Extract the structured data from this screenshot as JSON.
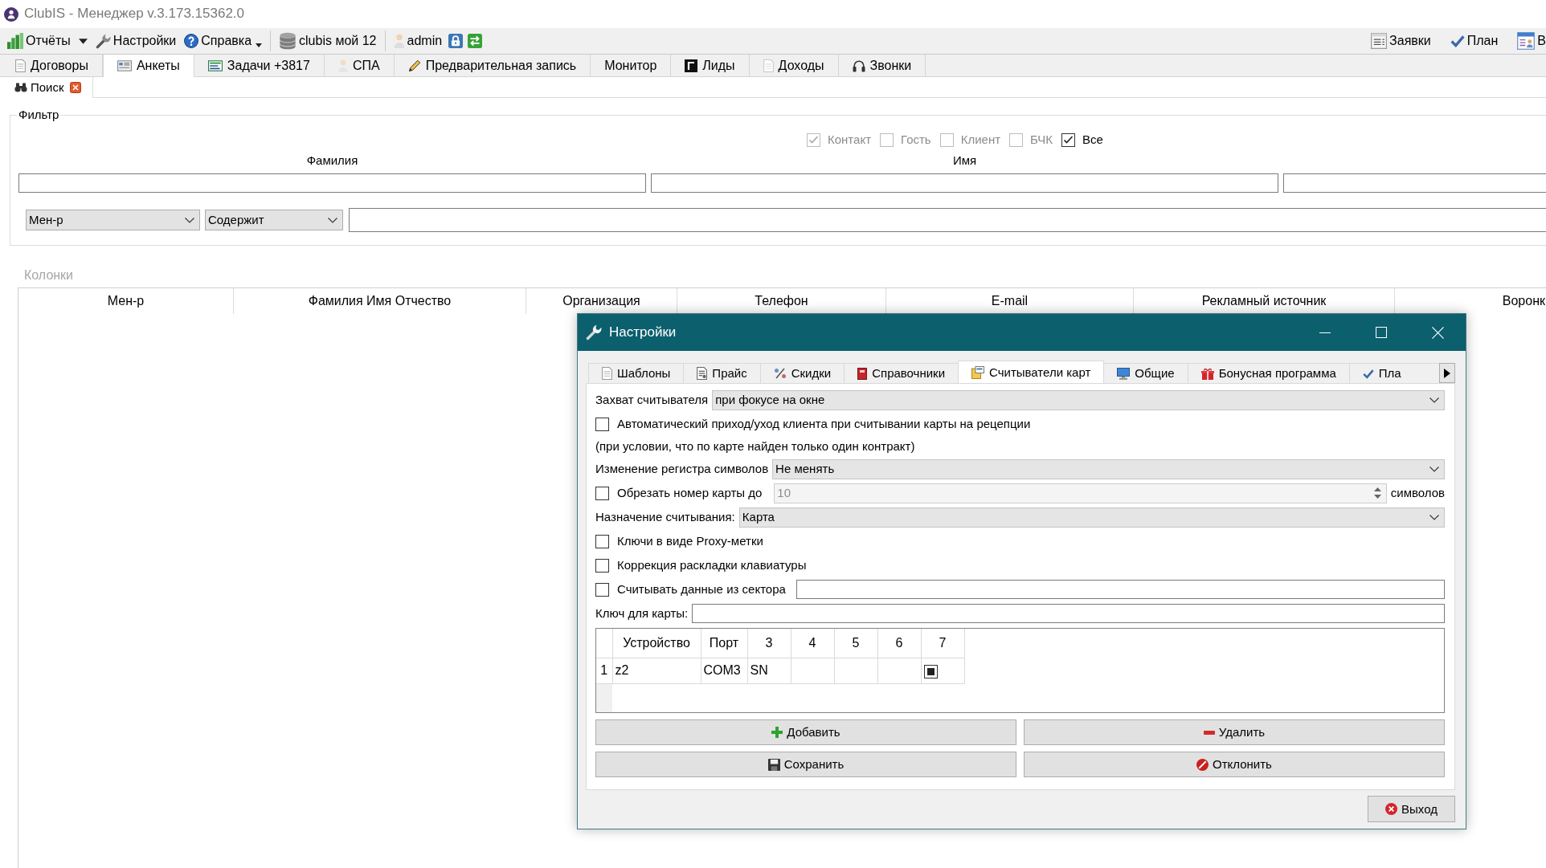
{
  "window": {
    "title": "ClubIS - Менеджер v.3.173.15362.0"
  },
  "toolbar": {
    "left": [
      {
        "kind": "button",
        "label": "Отчёты"
      },
      {
        "kind": "arrow"
      },
      {
        "kind": "button",
        "label": "Настройки"
      },
      {
        "kind": "menu",
        "label": "Справка"
      },
      {
        "kind": "separator"
      },
      {
        "kind": "button",
        "label": "clubis мой 12"
      },
      {
        "kind": "separator"
      },
      {
        "kind": "button",
        "label": "admin"
      },
      {
        "kind": "icon"
      },
      {
        "kind": "icon"
      }
    ],
    "right": [
      {
        "label": "Заявки"
      },
      {
        "label": "План"
      },
      {
        "label": "В"
      }
    ]
  },
  "main_tabs": [
    {
      "label": "Договоры",
      "selected": false
    },
    {
      "label": "Анкеты",
      "selected": true
    },
    {
      "label": "Задачи +3817",
      "selected": false
    },
    {
      "label": "СПА",
      "selected": false
    },
    {
      "label": "Предварительная запись",
      "selected": false
    },
    {
      "label": "Монитор",
      "selected": false
    },
    {
      "label": "Лиды",
      "selected": false
    },
    {
      "label": "Доходы",
      "selected": false
    },
    {
      "label": "Звонки",
      "selected": false
    }
  ],
  "sub_tabs": [
    {
      "label": "Поиск",
      "selected": true,
      "closable": true
    }
  ],
  "filter": {
    "title": "Фильтр",
    "checkboxes": [
      {
        "label": "Контакт",
        "checked": true,
        "disabled": true
      },
      {
        "label": "Гость",
        "checked": false,
        "disabled": true
      },
      {
        "label": "Клиент",
        "checked": false,
        "disabled": true
      },
      {
        "label": "БЧК",
        "checked": false,
        "disabled": true
      },
      {
        "label": "Все",
        "checked": true,
        "disabled": false
      }
    ],
    "name_fields": [
      {
        "kind": "labeled",
        "label": "Фамилия"
      },
      {
        "kind": "labeled",
        "label": "Имя"
      },
      {
        "kind": "unlabeled"
      }
    ],
    "search": {
      "field": "Мен-р",
      "operator": "Содержит"
    }
  },
  "columns_panel": {
    "title": "Колонки",
    "columns": [
      "Мен-р",
      "Фамилия Имя Отчество",
      "Организация",
      "Телефон",
      "E-mail",
      "Рекламный источник",
      "Воронк"
    ]
  },
  "dialog": {
    "title": "Настройки",
    "tabs": [
      {
        "label": "Шаблоны",
        "selected": false
      },
      {
        "label": "Прайс",
        "selected": false
      },
      {
        "label": "Скидки",
        "selected": false
      },
      {
        "label": "Справочники",
        "selected": false
      },
      {
        "label": "Считыватели карт",
        "selected": true
      },
      {
        "label": "Общие",
        "selected": false
      },
      {
        "label": "Бонусная программа",
        "selected": false
      },
      {
        "label": "Пла",
        "selected": false
      }
    ],
    "rows": [
      {
        "kind": "select",
        "label": "Захват считывателя",
        "value": "при фокусе на окне"
      },
      {
        "kind": "checkbox",
        "label": "Автоматический приход/уход клиента при считывании карты на рецепции",
        "checked": false
      },
      {
        "kind": "note",
        "text": "(при условии, что по карте найден только один контракт)"
      },
      {
        "kind": "select",
        "label": "Изменение регистра символов",
        "value": "Не менять"
      },
      {
        "kind": "spin",
        "label": "Обрезать номер карты до",
        "checked": false,
        "value": "10",
        "disabled": true,
        "suffix": "символов"
      },
      {
        "kind": "select",
        "label": "Назначение считывания:",
        "value": "Карта"
      },
      {
        "kind": "checkbox",
        "label": "Ключи в виде Proxy-метки",
        "checked": false
      },
      {
        "kind": "checkbox",
        "label": "Коррекция раскладки клавиатуры",
        "checked": false
      },
      {
        "kind": "checkbox_input",
        "label": "Считывать данные из сектора",
        "checked": false
      },
      {
        "kind": "input",
        "label": "Ключ для карты:"
      }
    ],
    "grid": {
      "columns": [
        "Устройство",
        "Порт",
        "3",
        "4",
        "5",
        "6",
        "7"
      ],
      "rows": [
        {
          "number": "1",
          "cells": [
            {
              "kind": "text",
              "text": "z2"
            },
            {
              "kind": "text",
              "text": "COM3"
            },
            {
              "kind": "text",
              "text": "SN"
            },
            {
              "kind": "empty"
            },
            {
              "kind": "empty"
            },
            {
              "kind": "empty"
            },
            {
              "kind": "checkbox",
              "checked": true
            }
          ]
        }
      ]
    },
    "buttons": [
      {
        "label": "Добавить"
      },
      {
        "label": "Удалить"
      },
      {
        "label": "Сохранить"
      },
      {
        "label": "Отклонить"
      }
    ],
    "exit_button": {
      "label": "Выход"
    }
  }
}
